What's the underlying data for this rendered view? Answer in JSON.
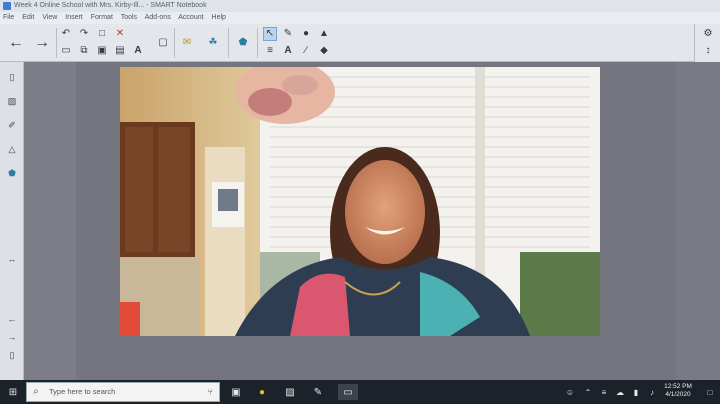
{
  "window": {
    "title": "Week 4 Online School with Mrs. Kirby-Ill... - SMART Notebook"
  },
  "menu": [
    "File",
    "Edit",
    "View",
    "Insert",
    "Format",
    "Tools",
    "Add-ons",
    "Account",
    "Help"
  ],
  "toolbar": {
    "back_icon": "arrow-left-icon",
    "forward_icon": "arrow-right-icon",
    "tools": [
      "undo-icon",
      "redo-icon",
      "page-icon",
      "delete-icon",
      "new-page-icon",
      "duplicate-icon",
      "save-icon",
      "screen-shade-icon",
      "document-camera-icon",
      "text-icon",
      "mail-icon",
      "lab-icon",
      "shapes-icon",
      "select-icon",
      "pen-icon",
      "fill-icon",
      "eraser-icon",
      "line-icon"
    ]
  },
  "sidebar": {
    "items": [
      "page-sorter-icon",
      "gallery-icon",
      "attachments-icon",
      "properties-icon",
      "addons-icon",
      "resize-icon",
      "back-page-icon",
      "next-page-icon",
      "more-icon"
    ]
  },
  "taskbar": {
    "search_placeholder": "Type here to search",
    "time": "12:52 PM",
    "date": "4/1/2020"
  },
  "colors": {
    "taskbar": "#1c2229",
    "toolbar": "#e3e6ea",
    "canvas": "#75757f",
    "select_active": "#bcd3ee"
  }
}
